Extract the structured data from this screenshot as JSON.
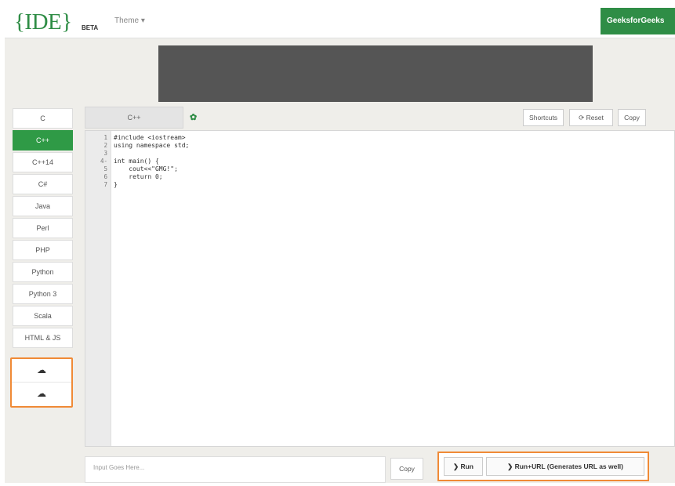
{
  "header": {
    "logo": "{IDE}",
    "beta": "BETA",
    "theme": "Theme ▾",
    "brand_button": "GeeksforGeeks"
  },
  "languages": [
    {
      "label": "C",
      "active": false
    },
    {
      "label": "C++",
      "active": true
    },
    {
      "label": "C++14",
      "active": false
    },
    {
      "label": "C#",
      "active": false
    },
    {
      "label": "Java",
      "active": false
    },
    {
      "label": "Perl",
      "active": false
    },
    {
      "label": "PHP",
      "active": false
    },
    {
      "label": "Python",
      "active": false
    },
    {
      "label": "Python 3",
      "active": false
    },
    {
      "label": "Scala",
      "active": false
    },
    {
      "label": "HTML & JS",
      "active": false
    }
  ],
  "upload_buttons": [
    "☁",
    "☁"
  ],
  "editor": {
    "tab_label": "C++",
    "gear_glyph": "✿",
    "buttons": {
      "shortcuts": "Shortcuts",
      "reset": "⟳ Reset",
      "copy": "Copy"
    },
    "expand_glyph": "⤢",
    "line_numbers": [
      "1",
      "2",
      "3",
      "4-",
      "5",
      "6",
      "7"
    ],
    "code": [
      "#include <iostream>",
      "using namespace std;",
      "",
      "int main() {",
      "    cout<<\"GMG!\";",
      "    return 0;",
      "}"
    ]
  },
  "footer": {
    "input_placeholder": "Input Goes Here...",
    "copy": "Copy",
    "run": "❯ Run",
    "run_url": "❯ Run+URL (Generates URL as well)"
  },
  "colors": {
    "accent": "#2f8d46",
    "highlight": "#f08a36",
    "ad": "#555555"
  },
  "icons": {
    "upload": "cloud-upload-icon",
    "settings": "gear-icon",
    "expand": "expand-icon",
    "reset": "reset-icon"
  }
}
